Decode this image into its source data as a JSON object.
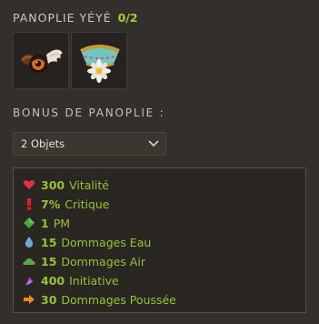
{
  "set": {
    "title": "PANOPLIE YÉYÉ",
    "count": "0/2",
    "items": [
      {
        "icon": "wing-eye-amulet-icon"
      },
      {
        "icon": "flower-cup-hat-icon"
      }
    ]
  },
  "bonus": {
    "heading": "BONUS DE PANOPLIE :",
    "selected": "2 Objets",
    "stats": [
      {
        "icon": "heart-icon",
        "color": "#e0304a",
        "value": "300",
        "label": "Vitalité"
      },
      {
        "icon": "exclamation-icon",
        "color": "#e02020",
        "value": "7%",
        "label": "Critique"
      },
      {
        "icon": "diamond-icon",
        "color": "#49a83a",
        "value": "1",
        "label": "PM"
      },
      {
        "icon": "water-drop-icon",
        "color": "#6aa9d8",
        "value": "15",
        "label": "Dommages Eau"
      },
      {
        "icon": "cloud-icon",
        "color": "#5aa845",
        "value": "15",
        "label": "Dommages Air"
      },
      {
        "icon": "initiative-icon",
        "color": "#a050d0",
        "value": "400",
        "label": "Initiative"
      },
      {
        "icon": "arrow-right-icon",
        "color": "#f08a20",
        "value": "30",
        "label": "Dommages Poussée"
      }
    ]
  }
}
